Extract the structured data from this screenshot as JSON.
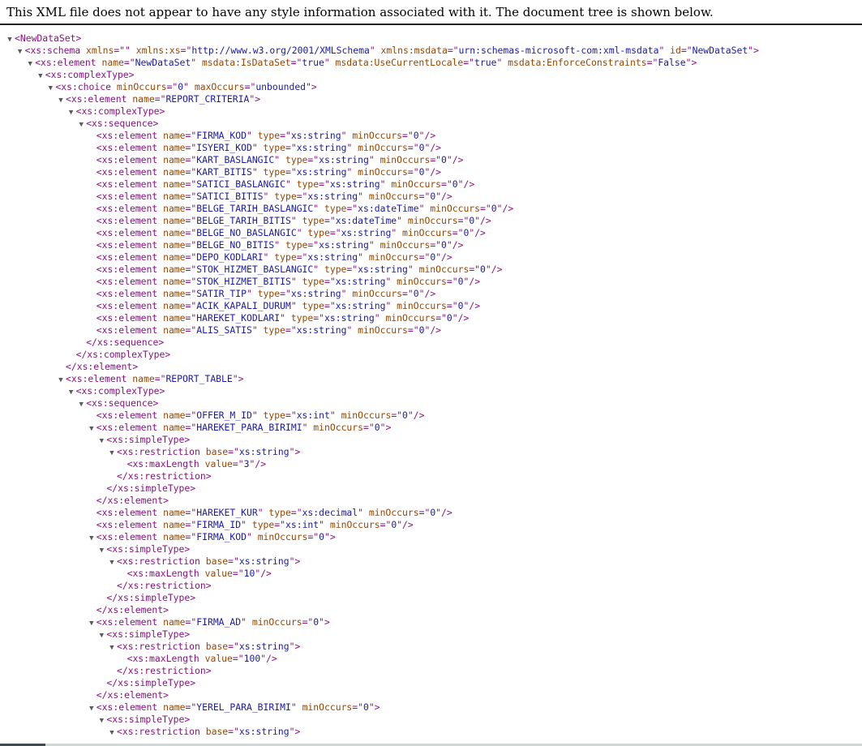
{
  "banner": "This XML file does not appear to have any style information associated with it. The document tree is shown below.",
  "tree": [
    {
      "d": 0,
      "t": 1,
      "k": "open",
      "name": "NewDataSet",
      "attrs": []
    },
    {
      "d": 1,
      "t": 1,
      "k": "open",
      "name": "xs:schema",
      "attrs": [
        [
          "xmlns",
          ""
        ],
        [
          "xmlns:xs",
          "http://www.w3.org/2001/XMLSchema"
        ],
        [
          "xmlns:msdata",
          "urn:schemas-microsoft-com:xml-msdata"
        ],
        [
          "id",
          "NewDataSet"
        ]
      ]
    },
    {
      "d": 2,
      "t": 1,
      "k": "open",
      "name": "xs:element",
      "attrs": [
        [
          "name",
          "NewDataSet"
        ],
        [
          "msdata:IsDataSet",
          "true"
        ],
        [
          "msdata:UseCurrentLocale",
          "true"
        ],
        [
          "msdata:EnforceConstraints",
          "False"
        ]
      ]
    },
    {
      "d": 3,
      "t": 1,
      "k": "open",
      "name": "xs:complexType",
      "attrs": []
    },
    {
      "d": 4,
      "t": 1,
      "k": "open",
      "name": "xs:choice",
      "attrs": [
        [
          "minOccurs",
          "0"
        ],
        [
          "maxOccurs",
          "unbounded"
        ]
      ]
    },
    {
      "d": 5,
      "t": 1,
      "k": "open",
      "name": "xs:element",
      "attrs": [
        [
          "name",
          "REPORT_CRITERIA"
        ]
      ]
    },
    {
      "d": 6,
      "t": 1,
      "k": "open",
      "name": "xs:complexType",
      "attrs": []
    },
    {
      "d": 7,
      "t": 1,
      "k": "open",
      "name": "xs:sequence",
      "attrs": []
    },
    {
      "d": 8,
      "t": 0,
      "k": "self",
      "name": "xs:element",
      "attrs": [
        [
          "name",
          "FIRMA_KOD"
        ],
        [
          "type",
          "xs:string"
        ],
        [
          "minOccurs",
          "0"
        ]
      ]
    },
    {
      "d": 8,
      "t": 0,
      "k": "self",
      "name": "xs:element",
      "attrs": [
        [
          "name",
          "ISYERI_KOD"
        ],
        [
          "type",
          "xs:string"
        ],
        [
          "minOccurs",
          "0"
        ]
      ]
    },
    {
      "d": 8,
      "t": 0,
      "k": "self",
      "name": "xs:element",
      "attrs": [
        [
          "name",
          "KART_BASLANGIC"
        ],
        [
          "type",
          "xs:string"
        ],
        [
          "minOccurs",
          "0"
        ]
      ]
    },
    {
      "d": 8,
      "t": 0,
      "k": "self",
      "name": "xs:element",
      "attrs": [
        [
          "name",
          "KART_BITIS"
        ],
        [
          "type",
          "xs:string"
        ],
        [
          "minOccurs",
          "0"
        ]
      ]
    },
    {
      "d": 8,
      "t": 0,
      "k": "self",
      "name": "xs:element",
      "attrs": [
        [
          "name",
          "SATICI_BASLANGIC"
        ],
        [
          "type",
          "xs:string"
        ],
        [
          "minOccurs",
          "0"
        ]
      ]
    },
    {
      "d": 8,
      "t": 0,
      "k": "self",
      "name": "xs:element",
      "attrs": [
        [
          "name",
          "SATICI_BITIS"
        ],
        [
          "type",
          "xs:string"
        ],
        [
          "minOccurs",
          "0"
        ]
      ]
    },
    {
      "d": 8,
      "t": 0,
      "k": "self",
      "name": "xs:element",
      "attrs": [
        [
          "name",
          "BELGE_TARIH_BASLANGIC"
        ],
        [
          "type",
          "xs:dateTime"
        ],
        [
          "minOccurs",
          "0"
        ]
      ]
    },
    {
      "d": 8,
      "t": 0,
      "k": "self",
      "name": "xs:element",
      "attrs": [
        [
          "name",
          "BELGE_TARIH_BITIS"
        ],
        [
          "type",
          "xs:dateTime"
        ],
        [
          "minOccurs",
          "0"
        ]
      ]
    },
    {
      "d": 8,
      "t": 0,
      "k": "self",
      "name": "xs:element",
      "attrs": [
        [
          "name",
          "BELGE_NO_BASLANGIC"
        ],
        [
          "type",
          "xs:string"
        ],
        [
          "minOccurs",
          "0"
        ]
      ]
    },
    {
      "d": 8,
      "t": 0,
      "k": "self",
      "name": "xs:element",
      "attrs": [
        [
          "name",
          "BELGE_NO_BITIS"
        ],
        [
          "type",
          "xs:string"
        ],
        [
          "minOccurs",
          "0"
        ]
      ]
    },
    {
      "d": 8,
      "t": 0,
      "k": "self",
      "name": "xs:element",
      "attrs": [
        [
          "name",
          "DEPO_KODLARI"
        ],
        [
          "type",
          "xs:string"
        ],
        [
          "minOccurs",
          "0"
        ]
      ]
    },
    {
      "d": 8,
      "t": 0,
      "k": "self",
      "name": "xs:element",
      "attrs": [
        [
          "name",
          "STOK_HIZMET_BASLANGIC"
        ],
        [
          "type",
          "xs:string"
        ],
        [
          "minOccurs",
          "0"
        ]
      ]
    },
    {
      "d": 8,
      "t": 0,
      "k": "self",
      "name": "xs:element",
      "attrs": [
        [
          "name",
          "STOK_HIZMET_BITIS"
        ],
        [
          "type",
          "xs:string"
        ],
        [
          "minOccurs",
          "0"
        ]
      ]
    },
    {
      "d": 8,
      "t": 0,
      "k": "self",
      "name": "xs:element",
      "attrs": [
        [
          "name",
          "SATIR_TIP"
        ],
        [
          "type",
          "xs:string"
        ],
        [
          "minOccurs",
          "0"
        ]
      ]
    },
    {
      "d": 8,
      "t": 0,
      "k": "self",
      "name": "xs:element",
      "attrs": [
        [
          "name",
          "ACIK_KAPALI_DURUM"
        ],
        [
          "type",
          "xs:string"
        ],
        [
          "minOccurs",
          "0"
        ]
      ]
    },
    {
      "d": 8,
      "t": 0,
      "k": "self",
      "name": "xs:element",
      "attrs": [
        [
          "name",
          "HAREKET_KODLARI"
        ],
        [
          "type",
          "xs:string"
        ],
        [
          "minOccurs",
          "0"
        ]
      ]
    },
    {
      "d": 8,
      "t": 0,
      "k": "self",
      "name": "xs:element",
      "attrs": [
        [
          "name",
          "ALIS_SATIS"
        ],
        [
          "type",
          "xs:string"
        ],
        [
          "minOccurs",
          "0"
        ]
      ]
    },
    {
      "d": 7,
      "t": 0,
      "k": "close",
      "name": "xs:sequence",
      "attrs": []
    },
    {
      "d": 6,
      "t": 0,
      "k": "close",
      "name": "xs:complexType",
      "attrs": []
    },
    {
      "d": 5,
      "t": 0,
      "k": "close",
      "name": "xs:element",
      "attrs": []
    },
    {
      "d": 5,
      "t": 1,
      "k": "open",
      "name": "xs:element",
      "attrs": [
        [
          "name",
          "REPORT_TABLE"
        ]
      ]
    },
    {
      "d": 6,
      "t": 1,
      "k": "open",
      "name": "xs:complexType",
      "attrs": []
    },
    {
      "d": 7,
      "t": 1,
      "k": "open",
      "name": "xs:sequence",
      "attrs": []
    },
    {
      "d": 8,
      "t": 0,
      "k": "self",
      "name": "xs:element",
      "attrs": [
        [
          "name",
          "OFFER_M_ID"
        ],
        [
          "type",
          "xs:int"
        ],
        [
          "minOccurs",
          "0"
        ]
      ]
    },
    {
      "d": 8,
      "t": 1,
      "k": "open",
      "name": "xs:element",
      "attrs": [
        [
          "name",
          "HAREKET_PARA_BIRIMI"
        ],
        [
          "minOccurs",
          "0"
        ]
      ]
    },
    {
      "d": 9,
      "t": 1,
      "k": "open",
      "name": "xs:simpleType",
      "attrs": []
    },
    {
      "d": 10,
      "t": 1,
      "k": "open",
      "name": "xs:restriction",
      "attrs": [
        [
          "base",
          "xs:string"
        ]
      ]
    },
    {
      "d": 11,
      "t": 0,
      "k": "self",
      "name": "xs:maxLength",
      "attrs": [
        [
          "value",
          "3"
        ]
      ]
    },
    {
      "d": 10,
      "t": 0,
      "k": "close",
      "name": "xs:restriction",
      "attrs": []
    },
    {
      "d": 9,
      "t": 0,
      "k": "close",
      "name": "xs:simpleType",
      "attrs": []
    },
    {
      "d": 8,
      "t": 0,
      "k": "close",
      "name": "xs:element",
      "attrs": []
    },
    {
      "d": 8,
      "t": 0,
      "k": "self",
      "name": "xs:element",
      "attrs": [
        [
          "name",
          "HAREKET_KUR"
        ],
        [
          "type",
          "xs:decimal"
        ],
        [
          "minOccurs",
          "0"
        ]
      ]
    },
    {
      "d": 8,
      "t": 0,
      "k": "self",
      "name": "xs:element",
      "attrs": [
        [
          "name",
          "FIRMA_ID"
        ],
        [
          "type",
          "xs:int"
        ],
        [
          "minOccurs",
          "0"
        ]
      ]
    },
    {
      "d": 8,
      "t": 1,
      "k": "open",
      "name": "xs:element",
      "attrs": [
        [
          "name",
          "FIRMA_KOD"
        ],
        [
          "minOccurs",
          "0"
        ]
      ]
    },
    {
      "d": 9,
      "t": 1,
      "k": "open",
      "name": "xs:simpleType",
      "attrs": []
    },
    {
      "d": 10,
      "t": 1,
      "k": "open",
      "name": "xs:restriction",
      "attrs": [
        [
          "base",
          "xs:string"
        ]
      ]
    },
    {
      "d": 11,
      "t": 0,
      "k": "self",
      "name": "xs:maxLength",
      "attrs": [
        [
          "value",
          "10"
        ]
      ]
    },
    {
      "d": 10,
      "t": 0,
      "k": "close",
      "name": "xs:restriction",
      "attrs": []
    },
    {
      "d": 9,
      "t": 0,
      "k": "close",
      "name": "xs:simpleType",
      "attrs": []
    },
    {
      "d": 8,
      "t": 0,
      "k": "close",
      "name": "xs:element",
      "attrs": []
    },
    {
      "d": 8,
      "t": 1,
      "k": "open",
      "name": "xs:element",
      "attrs": [
        [
          "name",
          "FIRMA_AD"
        ],
        [
          "minOccurs",
          "0"
        ]
      ]
    },
    {
      "d": 9,
      "t": 1,
      "k": "open",
      "name": "xs:simpleType",
      "attrs": []
    },
    {
      "d": 10,
      "t": 1,
      "k": "open",
      "name": "xs:restriction",
      "attrs": [
        [
          "base",
          "xs:string"
        ]
      ]
    },
    {
      "d": 11,
      "t": 0,
      "k": "self",
      "name": "xs:maxLength",
      "attrs": [
        [
          "value",
          "100"
        ]
      ]
    },
    {
      "d": 10,
      "t": 0,
      "k": "close",
      "name": "xs:restriction",
      "attrs": []
    },
    {
      "d": 9,
      "t": 0,
      "k": "close",
      "name": "xs:simpleType",
      "attrs": []
    },
    {
      "d": 8,
      "t": 0,
      "k": "close",
      "name": "xs:element",
      "attrs": []
    },
    {
      "d": 8,
      "t": 1,
      "k": "open",
      "name": "xs:element",
      "attrs": [
        [
          "name",
          "YEREL_PARA_BIRIMI"
        ],
        [
          "minOccurs",
          "0"
        ]
      ]
    },
    {
      "d": 9,
      "t": 1,
      "k": "open",
      "name": "xs:simpleType",
      "attrs": []
    },
    {
      "d": 10,
      "t": 1,
      "k": "open",
      "name": "xs:restriction",
      "attrs": [
        [
          "base",
          "xs:string"
        ]
      ]
    }
  ],
  "colors": {
    "tag": "#881280",
    "attr_name": "#994500",
    "attr_value": "#1a1aa6",
    "toggle": "#5a5a5a"
  },
  "icons": {
    "expand_toggle": "triangle-down-icon"
  }
}
